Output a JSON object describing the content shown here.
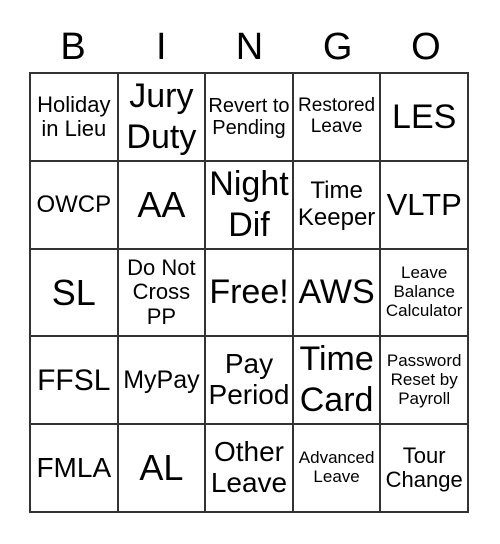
{
  "header": [
    "B",
    "I",
    "N",
    "G",
    "O"
  ],
  "cells": [
    "Holiday in Lieu",
    "Jury Duty",
    "Revert to Pending",
    "Restored Leave",
    "LES",
    "OWCP",
    "AA",
    "Night Dif",
    "Time Keeper",
    "VLTP",
    "SL",
    "Do Not Cross PP",
    "Free!",
    "AWS",
    "Leave Balance Calculator",
    "FFSL",
    "MyPay",
    "Pay Period",
    "Time Card",
    "Password Reset by Payroll",
    "FMLA",
    "AL",
    "Other Leave",
    "Advanced Leave",
    "Tour Change"
  ]
}
